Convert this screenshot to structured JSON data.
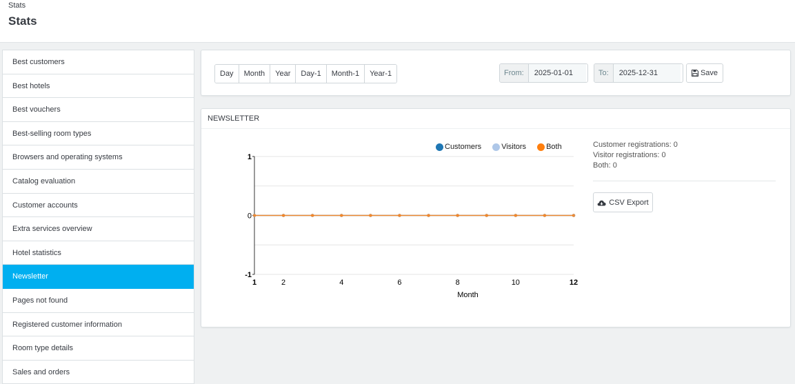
{
  "header": {
    "breadcrumb": "Stats",
    "title": "Stats"
  },
  "sidebar": {
    "items": [
      {
        "label": "Best customers",
        "active": false
      },
      {
        "label": "Best hotels",
        "active": false
      },
      {
        "label": "Best vouchers",
        "active": false
      },
      {
        "label": "Best-selling room types",
        "active": false
      },
      {
        "label": "Browsers and operating systems",
        "active": false
      },
      {
        "label": "Catalog evaluation",
        "active": false
      },
      {
        "label": "Customer accounts",
        "active": false
      },
      {
        "label": "Extra services overview",
        "active": false
      },
      {
        "label": "Hotel statistics",
        "active": false
      },
      {
        "label": "Newsletter",
        "active": true
      },
      {
        "label": "Pages not found",
        "active": false
      },
      {
        "label": "Registered customer information",
        "active": false
      },
      {
        "label": "Room type details",
        "active": false
      },
      {
        "label": "Sales and orders",
        "active": false
      }
    ],
    "active_color": "#00aff0"
  },
  "toolbar": {
    "periods": [
      "Day",
      "Month",
      "Year",
      "Day-1",
      "Month-1",
      "Year-1"
    ],
    "from_label": "From:",
    "from_value": "2025-01-01",
    "to_label": "To:",
    "to_value": "2025-12-31",
    "save_label": "Save",
    "save_icon": "save-icon"
  },
  "newsletter": {
    "title": "NEWSLETTER",
    "stats": {
      "customer_registrations": "Customer registrations: 0",
      "visitor_registrations": "Visitor registrations: 0",
      "both": "Both: 0"
    },
    "csv_label": "CSV Export",
    "csv_icon": "cloud-download-icon"
  },
  "chart_data": {
    "type": "line",
    "x": [
      1,
      2,
      3,
      4,
      5,
      6,
      7,
      8,
      9,
      10,
      11,
      12
    ],
    "xlabel": "Month",
    "ylabel": "",
    "ylim": [
      -1,
      1
    ],
    "xlim": [
      1,
      12
    ],
    "x_ticks": [
      "1",
      "2",
      "4",
      "6",
      "8",
      "10",
      "12"
    ],
    "y_ticks": [
      "1",
      "0",
      "-1"
    ],
    "grid": true,
    "legend_position": "top",
    "series": [
      {
        "name": "Customers",
        "color": "#1f77b4",
        "values": [
          0,
          0,
          0,
          0,
          0,
          0,
          0,
          0,
          0,
          0,
          0,
          0
        ]
      },
      {
        "name": "Visitors",
        "color": "#aec7e8",
        "values": [
          0,
          0,
          0,
          0,
          0,
          0,
          0,
          0,
          0,
          0,
          0,
          0
        ]
      },
      {
        "name": "Both",
        "color": "#ff7f0e",
        "values": [
          0,
          0,
          0,
          0,
          0,
          0,
          0,
          0,
          0,
          0,
          0,
          0
        ]
      }
    ]
  }
}
